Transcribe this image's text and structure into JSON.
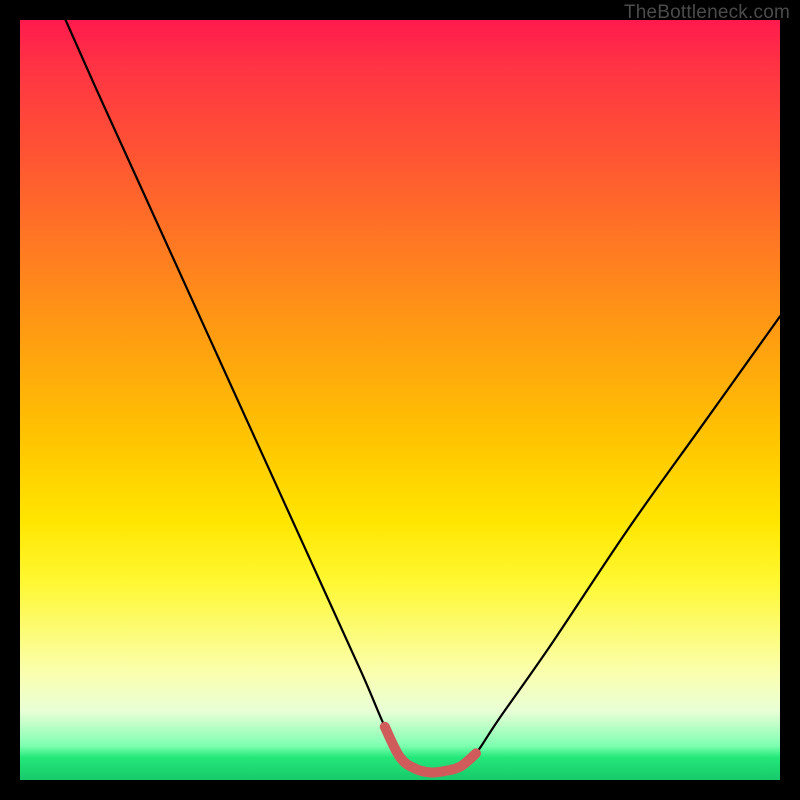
{
  "watermark": "TheBottleneck.com",
  "colors": {
    "frame": "#000000",
    "curve_stroke": "#000000",
    "highlight_stroke": "#cf5b5b",
    "gradient_top": "#ff1a4d",
    "gradient_bottom": "#17c96a"
  },
  "chart_data": {
    "type": "line",
    "title": "",
    "xlabel": "",
    "ylabel": "",
    "xlim": [
      0,
      100
    ],
    "ylim": [
      0,
      100
    ],
    "series": [
      {
        "name": "bottleneck-curve",
        "x": [
          6,
          10,
          15,
          20,
          25,
          30,
          35,
          40,
          45,
          48,
          50,
          52,
          54,
          56,
          58,
          60,
          63,
          70,
          80,
          90,
          100
        ],
        "values": [
          100,
          91,
          80,
          69,
          58,
          47,
          36,
          25,
          14,
          7,
          3,
          1.5,
          1,
          1.2,
          1.8,
          3.5,
          8,
          18,
          33,
          47,
          61
        ]
      },
      {
        "name": "optimal-band-highlight",
        "x": [
          48,
          50,
          52,
          54,
          56,
          58,
          60
        ],
        "values": [
          7,
          3,
          1.5,
          1,
          1.2,
          1.8,
          3.5
        ]
      }
    ],
    "annotations": []
  }
}
